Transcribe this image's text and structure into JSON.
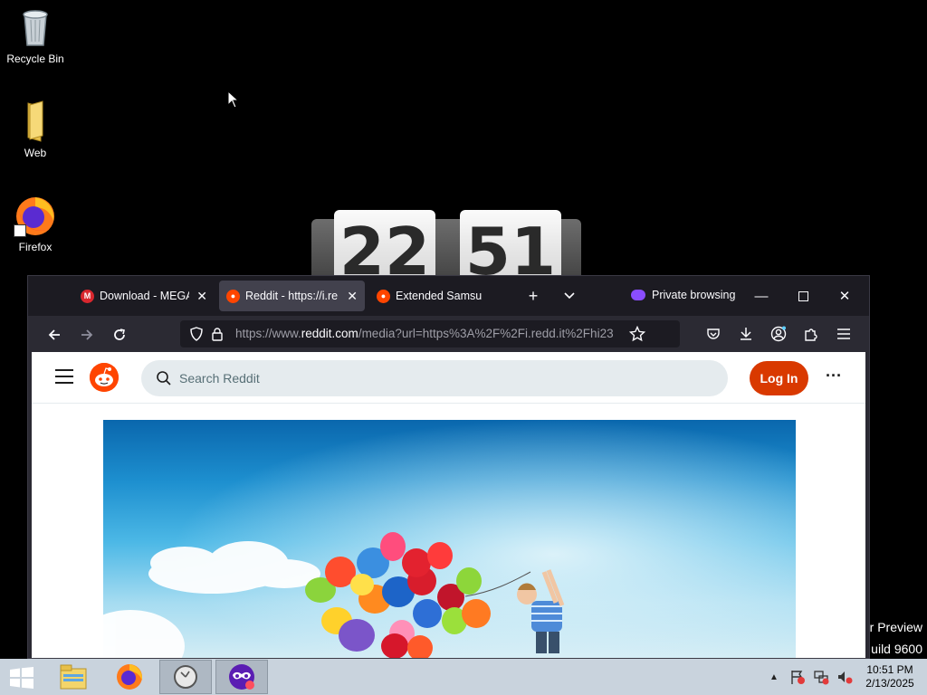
{
  "desktop": {
    "icons": [
      {
        "label": "Recycle Bin",
        "icon": "recycle-bin-icon"
      },
      {
        "label": "Web",
        "icon": "folder-icon"
      },
      {
        "label": "Firefox",
        "icon": "firefox-icon"
      }
    ],
    "clock_gadget": {
      "hours": "22",
      "minutes": "51"
    },
    "watermark": {
      "line1": "r Preview",
      "line2": "uild 9600"
    }
  },
  "browser": {
    "tabs": [
      {
        "title": "Download - MEGA",
        "icon": "mega-icon",
        "color": "#d9272e",
        "active": false
      },
      {
        "title": "Reddit - https://i.re",
        "icon": "reddit-icon",
        "color": "#ff4500",
        "active": true
      },
      {
        "title": "Extended Samsung",
        "icon": "reddit-icon",
        "color": "#ff4500",
        "active": false
      }
    ],
    "private_label": "Private browsing",
    "url": {
      "prefix": "https://www.",
      "host": "reddit.com",
      "rest": "/media?url=https%3A%2F%2Fi.redd.it%2Fhi23"
    },
    "page": {
      "search_placeholder": "Search Reddit",
      "login_label": "Log In",
      "more_label": "···"
    }
  },
  "taskbar": {
    "time": "10:51 PM",
    "date": "2/13/2025"
  },
  "colors": {
    "reddit_orange": "#ff4500",
    "login_button": "#d93900",
    "private_purple": "#8a4dff"
  }
}
